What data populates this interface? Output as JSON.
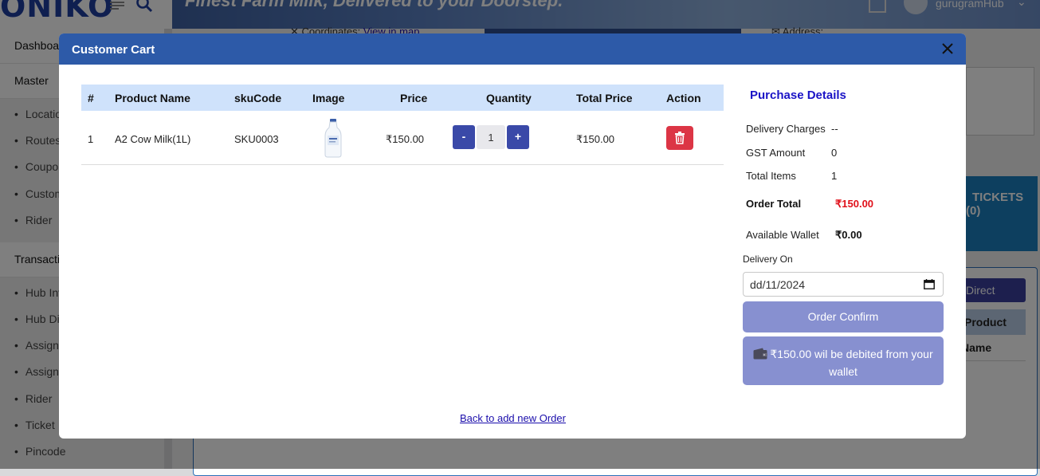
{
  "background": {
    "logo_text": "ONIKO",
    "tagline": "Finest Farm Milk, Delivered to your Doorstep.",
    "user_name": "gurugramHub",
    "sidebar": {
      "dashboard": "Dashboard",
      "master": "Master",
      "master_items": [
        "Location",
        "Routes",
        "Coupon",
        "Customer",
        "Rider"
      ],
      "transaction": "Transaction",
      "transaction_items": [
        "Hub Inventory",
        "Hub Dispatch",
        "Assign",
        "Assign",
        "Rider",
        "Ticket",
        "Pincode"
      ]
    },
    "coordinates_label": "Coordinates:",
    "coordinates_link": "View in map",
    "address_label": "Address:",
    "tickets_label": "TICKETS (0)",
    "direct_order_button": "Direct Order",
    "product_name_header": "Product Name"
  },
  "modal": {
    "title": "Customer Cart",
    "table": {
      "headers": [
        "#",
        "Product Name",
        "skuCode",
        "Image",
        "Price",
        "Quantity",
        "Total Price",
        "Action"
      ],
      "rows": [
        {
          "index": "1",
          "product_name": "A2 Cow Milk(1L)",
          "sku": "SKU0003",
          "price": "₹150.00",
          "quantity": "1",
          "total_price": "₹150.00",
          "minus_label": "-",
          "plus_label": "+"
        }
      ]
    },
    "purchase_details": {
      "title": "Purchase Details",
      "delivery_charges_label": "Delivery Charges",
      "delivery_charges_value": "--",
      "gst_label": "GST Amount",
      "gst_value": "0",
      "total_items_label": "Total Items",
      "total_items_value": "1",
      "order_total_label": "Order Total",
      "order_total_value": "₹150.00",
      "wallet_label": "Available Wallet",
      "wallet_value": "₹0.00",
      "delivery_on_label": "Delivery On",
      "delivery_on_value": "dd/11/2024",
      "confirm_button": "Order Confirm",
      "wallet_notice": "₹150.00 wil be debited from your wallet"
    },
    "back_link": "Back to add new Order"
  },
  "colors": {
    "header_blue": "#2d5aa8",
    "table_header": "#cfe2fb",
    "button_blue": "#3a49a8",
    "delete_red": "#dc3545",
    "confirm_purple": "#8790d0",
    "order_total_red": "#e0101a",
    "purchase_title_blue": "#1a13c6"
  }
}
